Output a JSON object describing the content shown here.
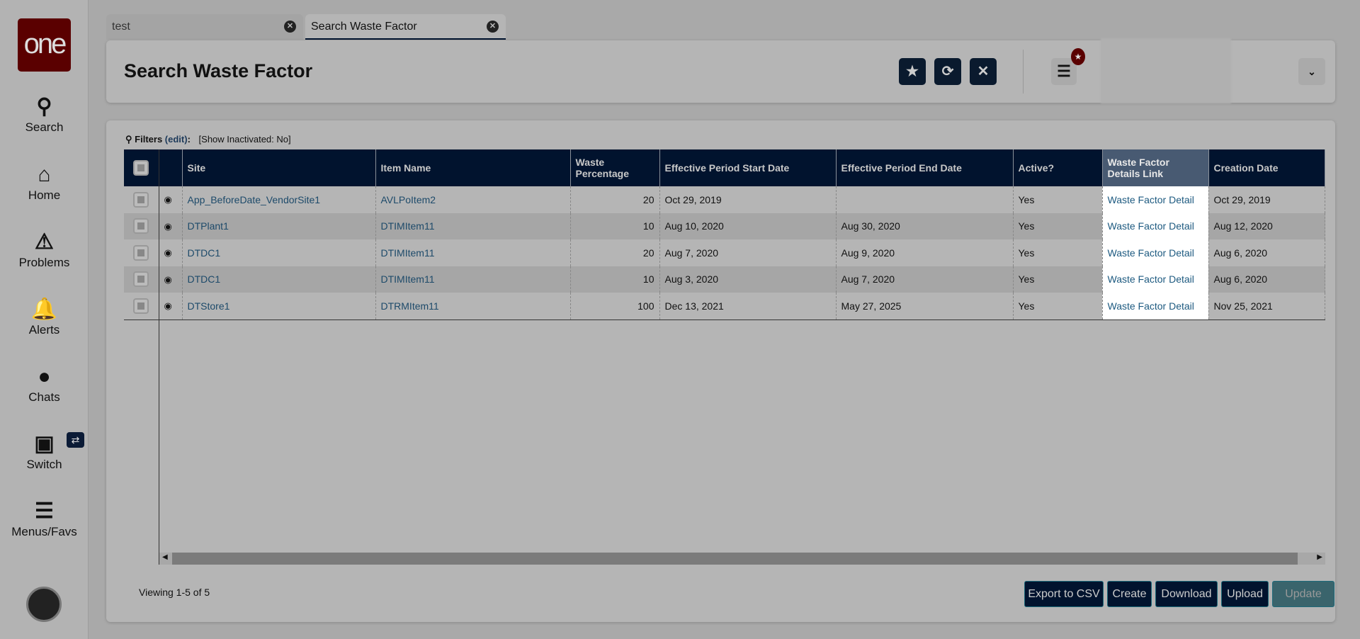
{
  "sidebar": {
    "logo": "one",
    "items": [
      {
        "label": "Search",
        "icon": "search-icon"
      },
      {
        "label": "Home",
        "icon": "home-icon"
      },
      {
        "label": "Problems",
        "icon": "warning-icon"
      },
      {
        "label": "Alerts",
        "icon": "bell-icon"
      },
      {
        "label": "Chats",
        "icon": "chat-icon"
      },
      {
        "label": "Switch",
        "icon": "switch-icon"
      },
      {
        "label": "Menus/Favs",
        "icon": "menu-icon"
      }
    ]
  },
  "tabs": [
    {
      "label": "test"
    },
    {
      "label": "Search Waste Factor",
      "active": true
    }
  ],
  "header": {
    "title": "Search Waste Factor"
  },
  "filters": {
    "label": "Filters",
    "edit": "(edit)",
    "colon": ":",
    "summary": "[Show Inactivated: No]"
  },
  "table": {
    "columns": [
      "Site",
      "Item Name",
      "Waste Percentage",
      "Effective Period Start Date",
      "Effective Period End Date",
      "Active?",
      "Waste Factor Details Link",
      "Creation Date"
    ],
    "rows": [
      [
        "App_BeforeDate_VendorSite1",
        "AVLPoItem2",
        "20",
        "Oct 29, 2019",
        "",
        "Yes",
        "Waste Factor Detail",
        "Oct 29, 2019"
      ],
      [
        "DTPlant1",
        "DTIMItem11",
        "10",
        "Aug 10, 2020",
        "Aug 30, 2020",
        "Yes",
        "Waste Factor Detail",
        "Aug 12, 2020"
      ],
      [
        "DTDC1",
        "DTIMItem11",
        "20",
        "Aug 7, 2020",
        "Aug 9, 2020",
        "Yes",
        "Waste Factor Detail",
        "Aug 6, 2020"
      ],
      [
        "DTDC1",
        "DTIMItem11",
        "10",
        "Aug 3, 2020",
        "Aug 7, 2020",
        "Yes",
        "Waste Factor Detail",
        "Aug 6, 2020"
      ],
      [
        "DTStore1",
        "DTRMItem11",
        "100",
        "Dec 13, 2021",
        "May 27, 2025",
        "Yes",
        "Waste Factor Detail",
        "Nov 25, 2021"
      ]
    ]
  },
  "footer": {
    "viewing": "Viewing 1-5 of 5",
    "buttons": [
      "Export to CSV",
      "Create",
      "Download",
      "Upload",
      "Update"
    ]
  }
}
